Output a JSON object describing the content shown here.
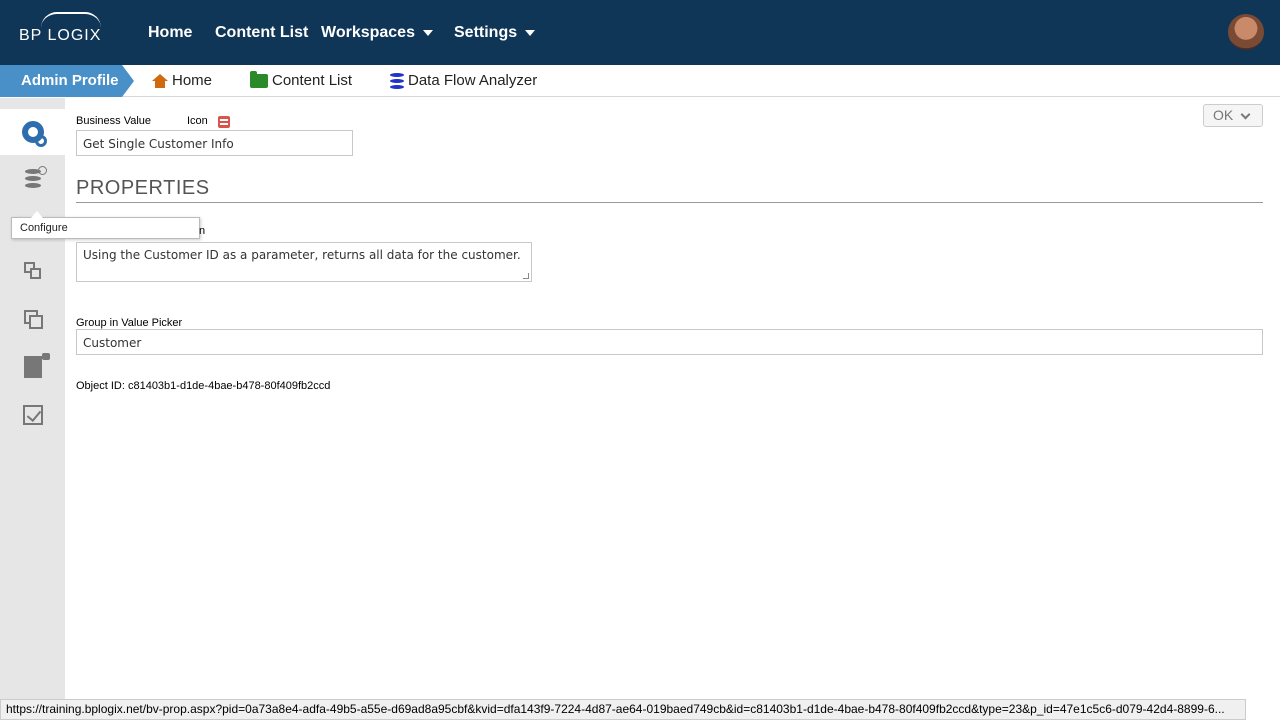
{
  "topnav": {
    "logo": "BP LOGIX",
    "items": [
      {
        "label": "Home"
      },
      {
        "label": "Content List"
      },
      {
        "label": "Workspaces"
      },
      {
        "label": "Settings"
      }
    ]
  },
  "breadcrumb": {
    "current": "Admin Profile",
    "links": [
      {
        "label": "Home",
        "icon": "home-icon"
      },
      {
        "label": "Content List",
        "icon": "folder-icon"
      },
      {
        "label": "Data Flow Analyzer",
        "icon": "database-icon"
      }
    ]
  },
  "sidebar": {
    "tooltip": "Configure"
  },
  "form": {
    "business_value_label": "Business Value",
    "icon_label": "Icon",
    "business_value": "Get Single Customer Info",
    "section_title": "PROPERTIES",
    "description_label_fragment": "n",
    "description": "Using the Customer ID as a parameter, returns all data for the customer.",
    "group_label": "Group in Value Picker",
    "group_value": "Customer",
    "object_id": "Object ID: c81403b1-d1de-4bae-b478-80f409fb2ccd",
    "ok_label": "OK"
  },
  "statusbar": {
    "url": "https://training.bplogix.net/bv-prop.aspx?pid=0a73a8e4-adfa-49b5-a55e-d69ad8a95cbf&kvid=dfa143f9-7224-4d87-ae64-019baed749cb&id=c81403b1-d1de-4bae-b478-80f409fb2ccd&type=23&p_id=47e1c5c6-d079-42d4-8899-6..."
  },
  "colors": {
    "nav_bg": "#0f3557",
    "accent": "#4a90c8",
    "icon_blue": "#2f6eae"
  }
}
